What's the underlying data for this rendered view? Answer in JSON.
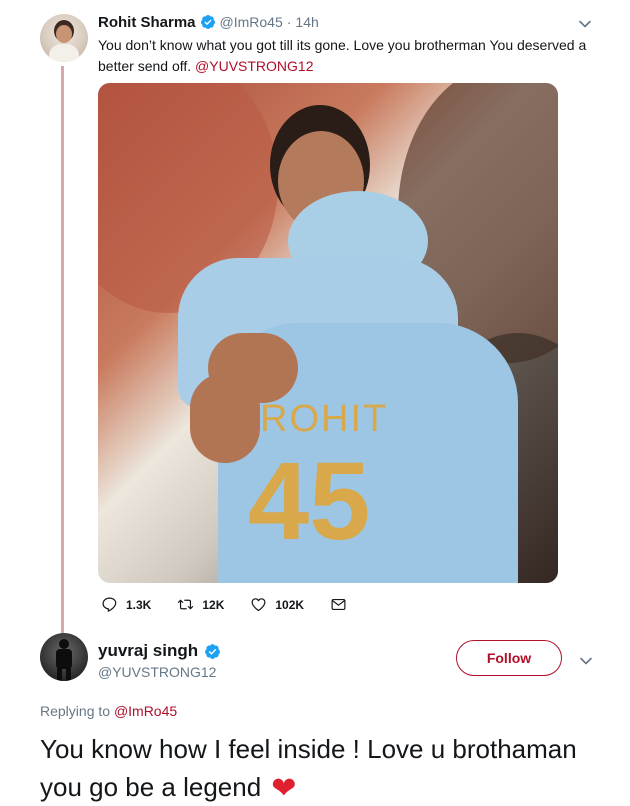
{
  "tweet": {
    "author_name": "Rohit Sharma",
    "author_handle": "@ImRo45",
    "separator": "·",
    "time": "14h",
    "text": "You don’t know what you got till its gone. Love you brotherman You deserved a better send off.",
    "mention": "@YUVSTRONG12",
    "media_description_icon": "photo-two-cricketers-embracing",
    "actions": {
      "replies": "1.3K",
      "retweets": "12K",
      "likes": "102K"
    }
  },
  "reply": {
    "author_name": "yuvraj singh",
    "author_handle": "@YUVSTRONG12",
    "follow_label": "Follow",
    "replying_prefix": "Replying to",
    "replying_to": "@ImRo45",
    "text": "You know how I feel inside ! Love u brothaman you go be a legend",
    "emoji": "❤"
  },
  "colors": {
    "accent": "#b00f28",
    "verified": "#1da1f2",
    "secondary_text": "#657786",
    "thread_line": "#d9a8ad"
  }
}
